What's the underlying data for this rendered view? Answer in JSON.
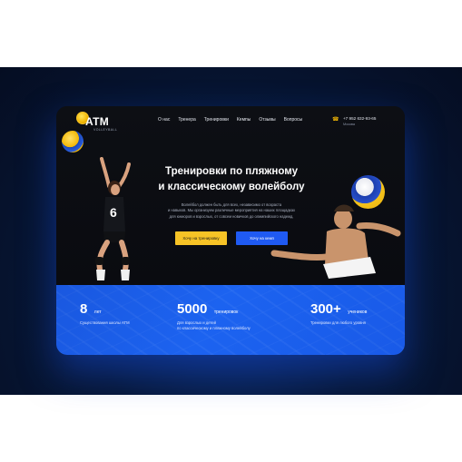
{
  "brand": {
    "logo_text": "ATM",
    "logo_sub": "VOLLEYBALL"
  },
  "nav": {
    "items": [
      "О нас",
      "Тренера",
      "Тренировки",
      "Кемпы",
      "Отзывы",
      "Вопросы"
    ]
  },
  "contact": {
    "phone": "+7 952 632-93-65",
    "city": "Москва"
  },
  "hero": {
    "title_line1": "Тренировки по пляжному",
    "title_line2": "и классическому волейболу",
    "desc_line1": "Волейбол должен быть для всех, независимо от возраста",
    "desc_line2": "и навыков. Мы организуем различные мероприятия на наших площадках",
    "desc_line3": "для юниоров и взрослых, от совсем новичков до олимпийского надежд.",
    "cta_training": "Хочу на тренировку",
    "cta_camp": "Хочу на кемп"
  },
  "stats": [
    {
      "number": "8",
      "unit": "лет",
      "caption_line1": "Существования школы АТМ",
      "caption_line2": ""
    },
    {
      "number": "5000",
      "unit": "тренировок",
      "caption_line1": "Для взрослых и детей",
      "caption_line2": "по классическому и пляжному волейболу"
    },
    {
      "number": "300+",
      "unit": "учеников",
      "caption_line1": "Тренировки для любого уровня",
      "caption_line2": ""
    }
  ],
  "colors": {
    "accent_yellow": "#f7c326",
    "accent_blue": "#1f5af2",
    "hero_bg": "#0b0d12"
  }
}
